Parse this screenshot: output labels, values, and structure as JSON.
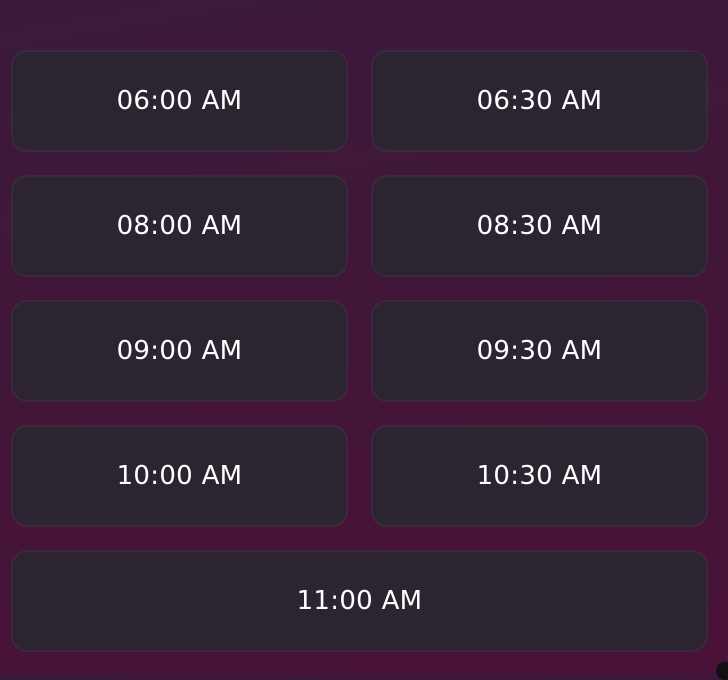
{
  "time_slots": [
    {
      "label": "06:00 AM"
    },
    {
      "label": "06:30 AM"
    },
    {
      "label": "08:00 AM"
    },
    {
      "label": "08:30 AM"
    },
    {
      "label": "09:00 AM"
    },
    {
      "label": "09:30 AM"
    },
    {
      "label": "10:00 AM"
    },
    {
      "label": "10:30 AM"
    },
    {
      "label": "11:00 AM"
    }
  ],
  "colors": {
    "background_top": "#3a1a3c",
    "background_bottom": "#4a1238",
    "slot_fill": "#2c2430",
    "slot_border": "#3a2a3c",
    "slot_text": "#ffffff"
  }
}
